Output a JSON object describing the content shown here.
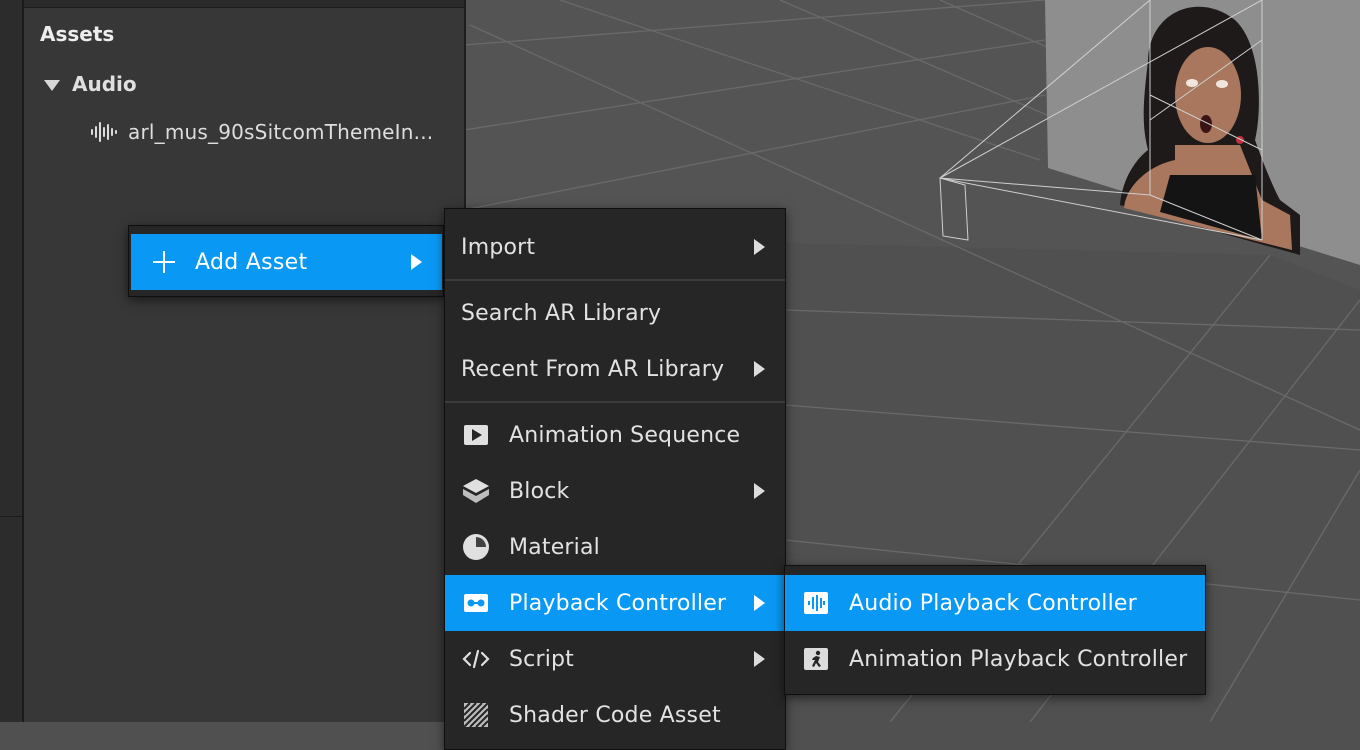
{
  "assets_panel": {
    "title": "Assets",
    "folder": {
      "label": "Audio",
      "icon": "triangle-down-icon"
    },
    "file": {
      "label": "arl_mus_90sSitcomThemeIn...",
      "icon": "audio-waveform-icon"
    }
  },
  "add_asset_menu": {
    "label": "Add Asset",
    "icon": "plus-icon"
  },
  "main_menu": {
    "items": [
      {
        "label": "Import",
        "has_submenu": true
      },
      {
        "label": "Search AR Library",
        "has_submenu": false
      },
      {
        "label": "Recent From AR Library",
        "has_submenu": true
      },
      {
        "label": "Animation Sequence",
        "icon": "animation-sequence-icon",
        "has_submenu": false
      },
      {
        "label": "Block",
        "icon": "block-icon",
        "has_submenu": true
      },
      {
        "label": "Material",
        "icon": "material-icon",
        "has_submenu": false
      },
      {
        "label": "Playback Controller",
        "icon": "playback-controller-icon",
        "has_submenu": true,
        "active": true
      },
      {
        "label": "Script",
        "icon": "script-icon",
        "has_submenu": true
      },
      {
        "label": "Shader Code Asset",
        "icon": "shader-code-icon",
        "has_submenu": false
      }
    ]
  },
  "sub_menu": {
    "items": [
      {
        "label": "Audio Playback Controller",
        "icon": "audio-playback-controller-icon",
        "active": true
      },
      {
        "label": "Animation Playback Controller",
        "icon": "animation-playback-controller-icon",
        "active": false
      }
    ]
  },
  "colors": {
    "accent": "#0a98f5",
    "menu_bg": "#262626",
    "panel_bg": "#373737",
    "viewport_bg": "#505050"
  }
}
